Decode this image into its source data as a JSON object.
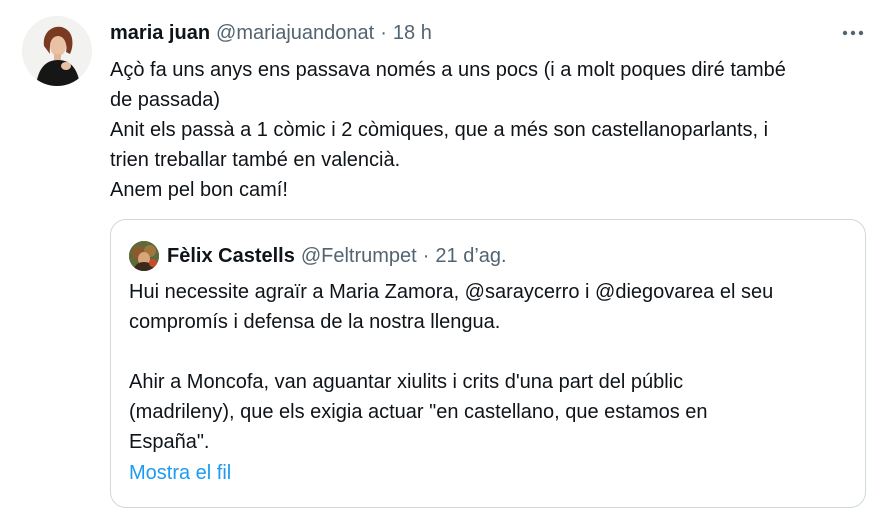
{
  "tweet": {
    "author": {
      "display_name": "maria juan",
      "handle": "@mariajuandonat",
      "separator": "·",
      "time": "18 h"
    },
    "more_icon": "more-horizontal-icon",
    "lines": [
      "Açò fa uns anys ens passava només a uns pocs (i a molt poques diré també",
      "de passada)",
      "Anit els passà a 1 còmic i 2 còmiques, que a més son castellanoparlants, i",
      "trien treballar també en valencià.",
      "Anem pel bon camí!"
    ]
  },
  "quote": {
    "author": {
      "display_name": "Fèlix Castells",
      "handle": "@Feltrumpet",
      "separator": "·",
      "time": "21 d’ag."
    },
    "lines": [
      "Hui necessite agraïr a Maria Zamora, @saraycerro i @diegovarea el seu",
      "compromís i defensa de la nostra llengua.",
      "",
      "Ahir a Moncofa, van aguantar xiulits i crits d'una part del públic",
      "(madrileny), que els exigia actuar \"en castellano, que estamos en",
      "España\"."
    ],
    "show_thread": "Mostra el fil"
  },
  "colors": {
    "text": "#0f1419",
    "secondary": "#536471",
    "link": "#1d9bf0",
    "border": "#cfd9de"
  }
}
